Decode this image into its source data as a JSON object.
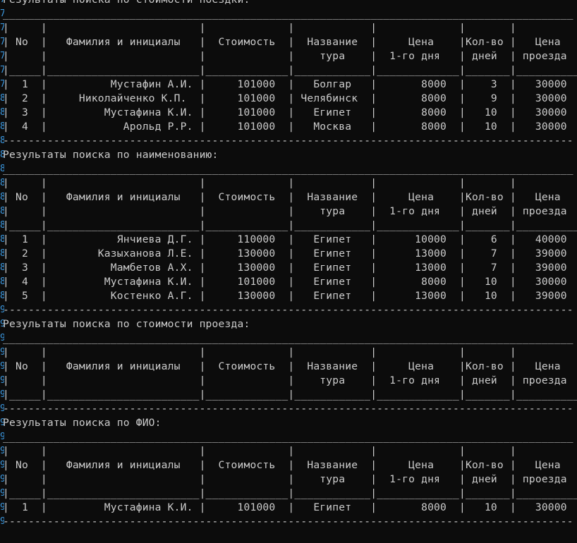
{
  "console": {
    "lines": [
      "Результаты поиска по стоимости поездки:",
      "__________________________________________________________________________________________",
      "|     |                        |             |            |             |       |          |",
      "| No  |   Фамилия и инициалы   |  Стоимость  |  Название  |     Цена    |Кол-во |   Цена   |",
      "|     |                        |             |    тура    |  1-го дня   | дней  | проезда  |",
      "|_____|________________________|_____________|____________|_____________|_______|__________|",
      "|  1  |          Мустафин А.И. |     101000  |   Болгар   |       8000  |    3  |   30000  |",
      "|  2  |     Николайченко К.П.  |     101000  | Челябинск  |       8000  |    9  |   30000  |",
      "|  3  |         Мустафина К.И. |     101000  |   Египет   |       8000  |   10  |   30000  |",
      "|  4  |            Арольд Р.Р. |     101000  |   Москва   |       8000  |   10  |   30000  |",
      "------------------------------------------------------------------------------------------",
      "Результаты поиска по наименованию:",
      "__________________________________________________________________________________________",
      "|     |                        |             |            |             |       |          |",
      "| No  |   Фамилия и инициалы   |  Стоимость  |  Название  |     Цена    |Кол-во |   Цена   |",
      "|     |                        |             |    тура    |  1-го дня   | дней  | проезда  |",
      "|_____|________________________|_____________|____________|_____________|_______|__________|",
      "|  1  |           Янчиева Д.Г. |     110000  |   Египет   |      10000  |    6  |   40000  |",
      "|  2  |        Казыханова Л.Е. |     130000  |   Египет   |      13000  |    7  |   39000  |",
      "|  3  |          Мамбетов А.Х. |     130000  |   Египет   |      13000  |    7  |   39000  |",
      "|  4  |         Мустафина К.И. |     101000  |   Египет   |       8000  |   10  |   30000  |",
      "|  5  |          Костенко А.Г. |     130000  |   Египет   |      13000  |   10  |   39000  |",
      "------------------------------------------------------------------------------------------",
      "Результаты поиска по стоимости проезда:",
      "__________________________________________________________________________________________",
      "|     |                        |             |            |             |       |          |",
      "| No  |   Фамилия и инициалы   |  Стоимость  |  Название  |     Цена    |Кол-во |   Цена   |",
      "|     |                        |             |    тура    |  1-го дня   | дней  | проезда  |",
      "|_____|________________________|_____________|____________|_____________|_______|__________|",
      "------------------------------------------------------------------------------------------",
      "Результаты поиска по ФИО:",
      "__________________________________________________________________________________________",
      "|     |                        |             |            |             |       |          |",
      "| No  |   Фамилия и инициалы   |  Стоимость  |  Название  |     Цена    |Кол-во |   Цена   |",
      "|     |                        |             |    тура    |  1-го дня   | дней  | проезда  |",
      "|_____|________________________|_____________|____________|_____________|_______|__________|",
      "|  1  |         Мустафина К.И. |     101000  |   Египет   |       8000  |   10  |   30000  |",
      "------------------------------------------------------------------------------------------"
    ],
    "gutter": [
      "7",
      "7",
      "7",
      "7",
      "7",
      "7",
      "7",
      "8",
      "8",
      "8",
      "8",
      "8",
      "8",
      "8",
      "8",
      "8",
      "8",
      "8",
      "8",
      "8",
      "8",
      "8",
      "9",
      "9",
      "9",
      "9",
      "9",
      "9",
      "9",
      "9",
      "9",
      "9",
      "9",
      "9",
      "9",
      "9",
      "9",
      "9"
    ]
  },
  "colors": {
    "background": "#0c0c0c",
    "text": "#cccccc",
    "gutter": "#3a96dd"
  }
}
